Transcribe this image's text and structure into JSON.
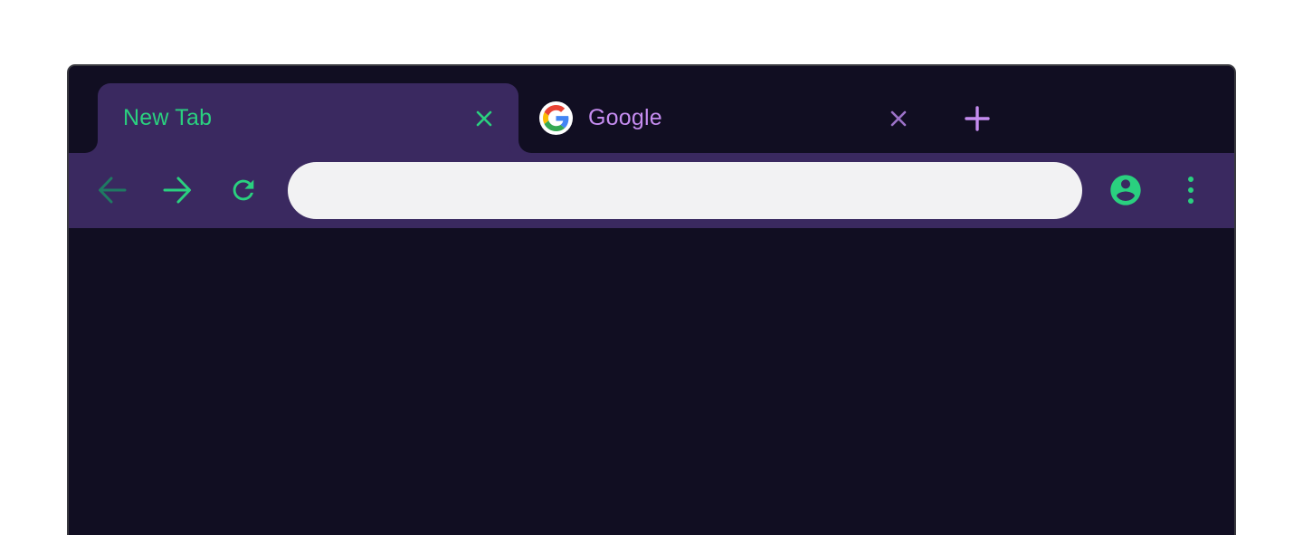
{
  "colors": {
    "background": "#ffffff",
    "window_frame": "#110e22",
    "toolbar": "#3a2960",
    "accent_green": "#2ad07f",
    "accent_purple": "#c58cf0",
    "omnibox": "#f2f2f3"
  },
  "tabs": [
    {
      "title": "New Tab",
      "active": true,
      "close_icon": "close-icon"
    },
    {
      "title": "Google",
      "active": false,
      "favicon": "google-g-icon",
      "close_icon": "close-icon"
    }
  ],
  "new_tab_icon": "plus-icon",
  "toolbar": {
    "back_icon": "arrow-left-icon",
    "back_enabled": false,
    "forward_icon": "arrow-right-icon",
    "reload_icon": "reload-icon",
    "profile_icon": "account-circle-icon",
    "menu_icon": "vertical-dots-icon"
  },
  "omnibox": {
    "value": "",
    "placeholder": ""
  }
}
